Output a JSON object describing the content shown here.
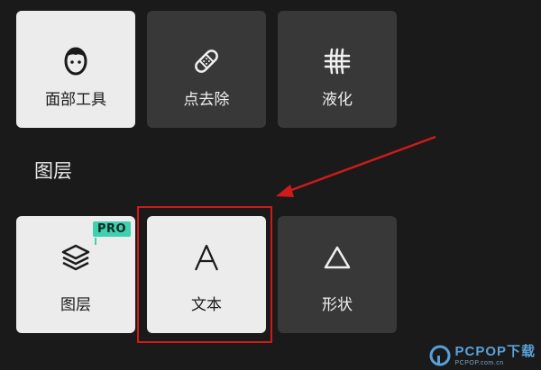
{
  "tools": [
    {
      "label": "面部工具",
      "icon": "face-icon"
    },
    {
      "label": "点去除",
      "icon": "bandage-icon"
    },
    {
      "label": "液化",
      "icon": "grid-icon"
    }
  ],
  "section": {
    "title": "图层"
  },
  "layers": [
    {
      "label": "图层",
      "icon": "layers-icon",
      "badge": "PRO"
    },
    {
      "label": "文本",
      "icon": "text-a-icon"
    },
    {
      "label": "形状",
      "icon": "triangle-icon"
    }
  ],
  "annotation": {
    "color": "#d01a1a"
  },
  "watermark": {
    "brand": "PCPOP下载",
    "subtitle": "PCPOP.com.cn"
  }
}
